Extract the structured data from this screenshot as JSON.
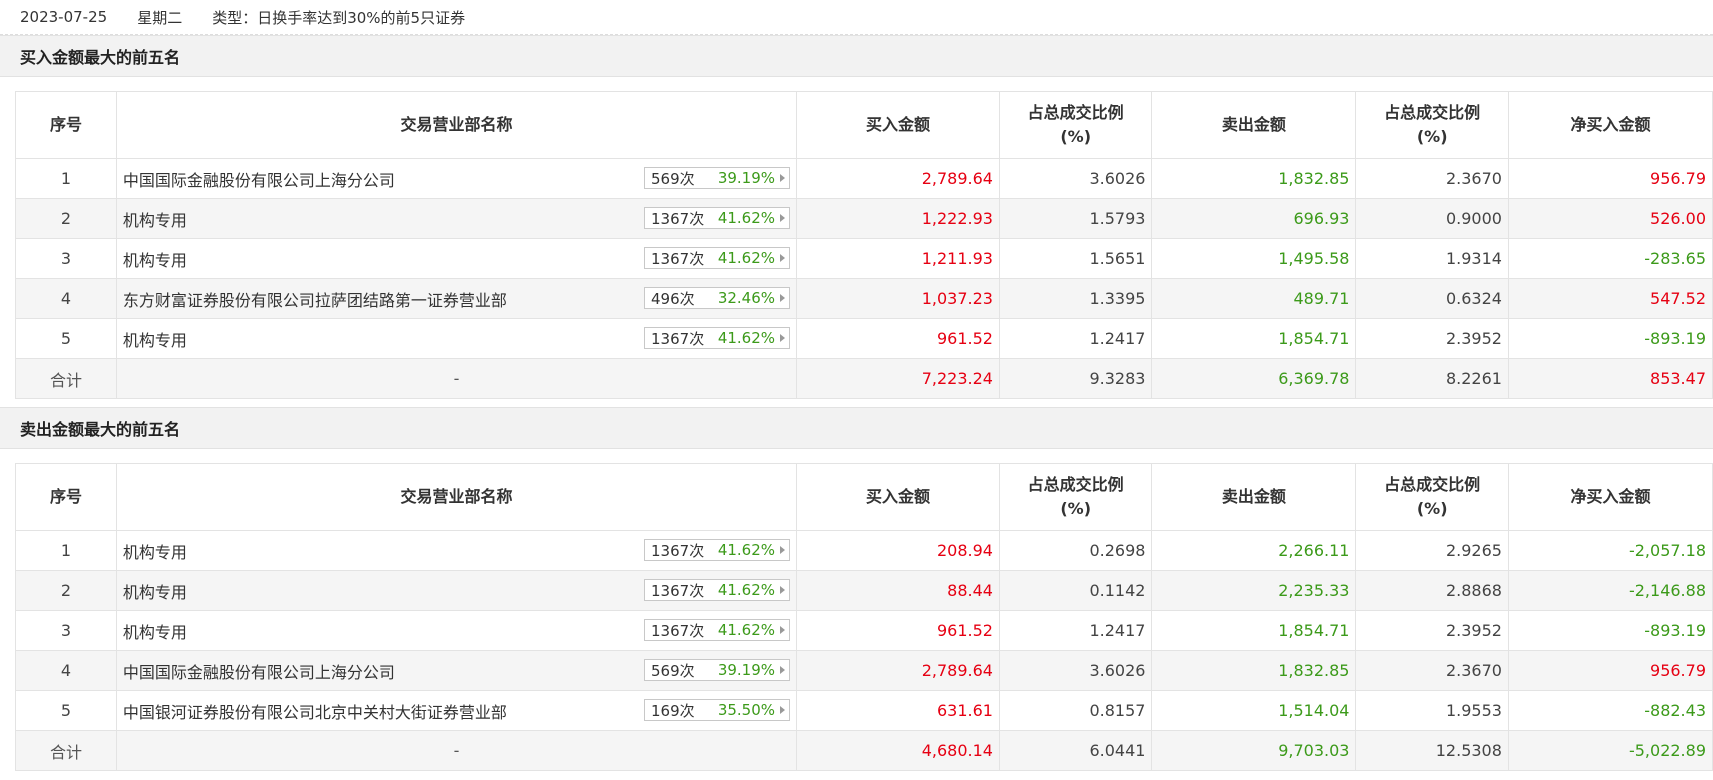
{
  "header": {
    "date": "2023-07-25",
    "weekday": "星期二",
    "type": "类型：日换手率达到30%的前5只证券"
  },
  "columns": [
    "序号",
    "交易营业部名称",
    "买入金额",
    "占总成交比例\n(%)",
    "卖出金额",
    "占总成交比例\n(%)",
    "净买入金额"
  ],
  "buy_section": {
    "title": "买入金额最大的前五名",
    "rows": [
      {
        "idx": "1",
        "name": "中国国际金融股份有限公司上海分公司",
        "times": "569次",
        "pct": "39.19%",
        "buy": "2,789.64",
        "buy_ratio": "3.6026",
        "sell": "1,832.85",
        "sell_ratio": "2.3670",
        "net": "956.79"
      },
      {
        "idx": "2",
        "name": "机构专用",
        "times": "1367次",
        "pct": "41.62%",
        "buy": "1,222.93",
        "buy_ratio": "1.5793",
        "sell": "696.93",
        "sell_ratio": "0.9000",
        "net": "526.00"
      },
      {
        "idx": "3",
        "name": "机构专用",
        "times": "1367次",
        "pct": "41.62%",
        "buy": "1,211.93",
        "buy_ratio": "1.5651",
        "sell": "1,495.58",
        "sell_ratio": "1.9314",
        "net": "-283.65"
      },
      {
        "idx": "4",
        "name": "东方财富证券股份有限公司拉萨团结路第一证券营业部",
        "times": "496次",
        "pct": "32.46%",
        "buy": "1,037.23",
        "buy_ratio": "1.3395",
        "sell": "489.71",
        "sell_ratio": "0.6324",
        "net": "547.52"
      },
      {
        "idx": "5",
        "name": "机构专用",
        "times": "1367次",
        "pct": "41.62%",
        "buy": "961.52",
        "buy_ratio": "1.2417",
        "sell": "1,854.71",
        "sell_ratio": "2.3952",
        "net": "-893.19"
      }
    ],
    "total": {
      "label": "合计",
      "name": "-",
      "buy": "7,223.24",
      "buy_ratio": "9.3283",
      "sell": "6,369.78",
      "sell_ratio": "8.2261",
      "net": "853.47"
    }
  },
  "sell_section": {
    "title": "卖出金额最大的前五名",
    "rows": [
      {
        "idx": "1",
        "name": "机构专用",
        "times": "1367次",
        "pct": "41.62%",
        "buy": "208.94",
        "buy_ratio": "0.2698",
        "sell": "2,266.11",
        "sell_ratio": "2.9265",
        "net": "-2,057.18"
      },
      {
        "idx": "2",
        "name": "机构专用",
        "times": "1367次",
        "pct": "41.62%",
        "buy": "88.44",
        "buy_ratio": "0.1142",
        "sell": "2,235.33",
        "sell_ratio": "2.8868",
        "net": "-2,146.88"
      },
      {
        "idx": "3",
        "name": "机构专用",
        "times": "1367次",
        "pct": "41.62%",
        "buy": "961.52",
        "buy_ratio": "1.2417",
        "sell": "1,854.71",
        "sell_ratio": "2.3952",
        "net": "-893.19"
      },
      {
        "idx": "4",
        "name": "中国国际金融股份有限公司上海分公司",
        "times": "569次",
        "pct": "39.19%",
        "buy": "2,789.64",
        "buy_ratio": "3.6026",
        "sell": "1,832.85",
        "sell_ratio": "2.3670",
        "net": "956.79"
      },
      {
        "idx": "5",
        "name": "中国银河证券股份有限公司北京中关村大街证券营业部",
        "times": "169次",
        "pct": "35.50%",
        "buy": "631.61",
        "buy_ratio": "0.8157",
        "sell": "1,514.04",
        "sell_ratio": "1.9553",
        "net": "-882.43"
      }
    ],
    "total": {
      "label": "合计",
      "name": "-",
      "buy": "4,680.14",
      "buy_ratio": "6.0441",
      "sell": "9,703.03",
      "sell_ratio": "12.5308",
      "net": "-5,022.89"
    }
  },
  "colors": {
    "up": "#e60012",
    "down": "#3c9a1a"
  }
}
